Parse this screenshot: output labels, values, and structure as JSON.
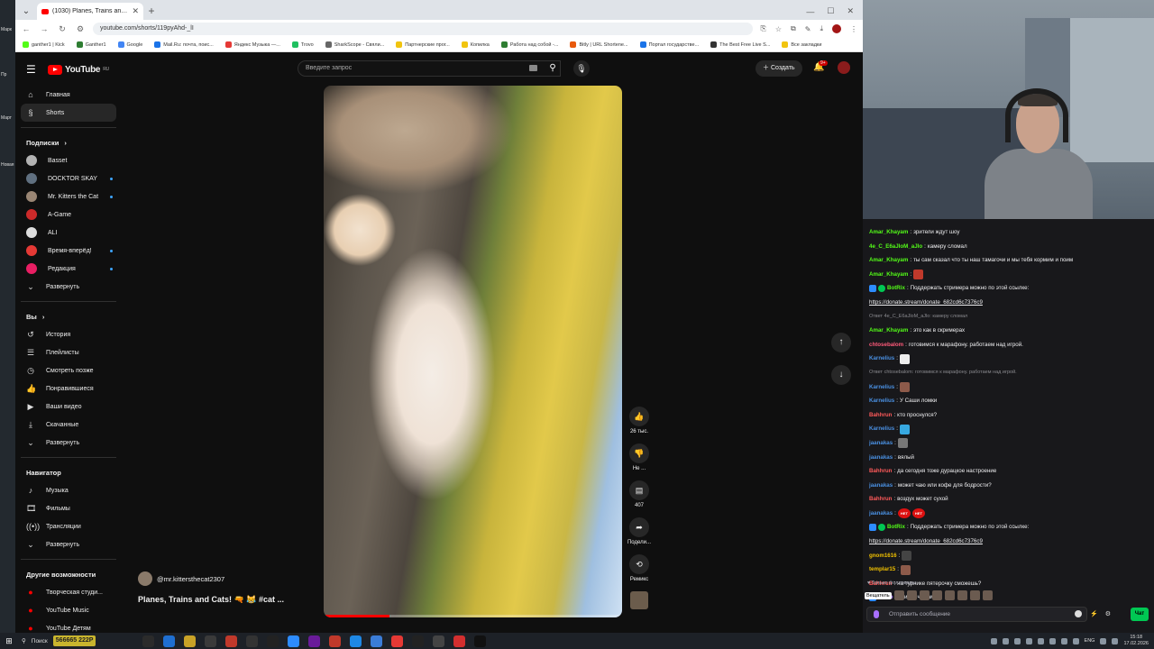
{
  "browser": {
    "tab_title": "(1030) Planes, Trains and C...",
    "url": "youtube.com/shorts/119pyAhd-_lI",
    "bookmarks": [
      "ganther1 | Kick",
      "Ganther1",
      "Google",
      "Mail.Ru: почта, поис...",
      "Яндекс Музыка —...",
      "Trovo",
      "SharkScope - Свяли...",
      "Партнерские прог...",
      "Копилка",
      "Работа над собой -...",
      "Bitly | URL Shortene...",
      "Портал государстве...",
      "The Best Free Live S...",
      "Все закладки"
    ],
    "bookmark_colors": [
      "#53fc18",
      "#2e7d32",
      "#4285f4",
      "#1a73e8",
      "#e53935",
      "#20c060",
      "#666666",
      "#f1c40f",
      "#f1c40f",
      "#2e7d32",
      "#e8590c",
      "#1a73e8",
      "#333333",
      "#f1c40f"
    ]
  },
  "youtube": {
    "logo_text": "YouTube",
    "region": "RU",
    "search_placeholder": "Введите запрос",
    "create_label": "Создать",
    "notifications": "9+",
    "sidebar": {
      "main": [
        {
          "label": "Главная",
          "icon": "home-icon",
          "glyph": "⌂"
        },
        {
          "label": "Shorts",
          "icon": "shorts-icon",
          "glyph": "§"
        }
      ],
      "subs_header": "Подписки",
      "subs": [
        {
          "label": "Basset",
          "color": "#b3b3b3",
          "live": false
        },
        {
          "label": "DOCKTOR SKAY",
          "color": "#607080",
          "live": true
        },
        {
          "label": "Mr. Kitters the Cat",
          "color": "#9a8674",
          "live": true
        },
        {
          "label": "A-Game",
          "color": "#cc2a2a",
          "live": false
        },
        {
          "label": "ALI",
          "color": "#dddddd",
          "live": false
        },
        {
          "label": "Время-вперёд!",
          "color": "#e53935",
          "live": true
        },
        {
          "label": "Редакция",
          "color": "#e91e63",
          "live": true
        }
      ],
      "subs_expand": "Развернуть",
      "you_header": "Вы",
      "you_items": [
        {
          "label": "История",
          "glyph": "↺"
        },
        {
          "label": "Плейлисты",
          "glyph": "☰"
        },
        {
          "label": "Смотреть позже",
          "glyph": "◷"
        },
        {
          "label": "Понравившиеся",
          "glyph": "👍"
        },
        {
          "label": "Ваши видео",
          "glyph": "▶"
        },
        {
          "label": "Скачанные",
          "glyph": "⤓"
        },
        {
          "label": "Развернуть",
          "glyph": "⌄"
        }
      ],
      "nav_header": "Навигатор",
      "nav_items": [
        {
          "label": "Музыка",
          "glyph": "♪"
        },
        {
          "label": "Фильмы",
          "glyph": "🎞"
        },
        {
          "label": "Трансляции",
          "glyph": "((•))"
        },
        {
          "label": "Развернуть",
          "glyph": "⌄"
        }
      ],
      "more_header": "Другие возможности",
      "more_items": [
        "Творческая студи...",
        "YouTube Music",
        "YouTube Детям"
      ]
    },
    "short": {
      "channel": "@mr.kittersthecat2307",
      "title": "Planes, Trains and Cats! 🔫 😹 #cat ...",
      "progress": 0.22,
      "actions": [
        {
          "icon": "like-icon",
          "glyph": "👍",
          "label": "26 тыс."
        },
        {
          "icon": "dislike-icon",
          "glyph": "👎",
          "label": "Не ..."
        },
        {
          "icon": "comment-icon",
          "glyph": "▤",
          "label": "407"
        },
        {
          "icon": "share-icon",
          "glyph": "➦",
          "label": "Подели..."
        },
        {
          "icon": "remix-icon",
          "glyph": "⟲",
          "label": "Ремикс"
        }
      ]
    }
  },
  "chat": {
    "messages": [
      {
        "user": "Amar_Khayam",
        "color": "#53fc18",
        "text": "зрители ждут шоу"
      },
      {
        "user": "4e_C_E6aJloM_aJlo",
        "color": "#53fc18",
        "text": "камеру сломал"
      },
      {
        "user": "Amar_Khayam",
        "color": "#53fc18",
        "text": "ты сам сказал что ты наш тамагочи и мы тебя кормим и поим"
      },
      {
        "user": "Amar_Khayam",
        "color": "#53fc18",
        "text": "",
        "emote": "#c0392b"
      },
      {
        "user": "BotRix",
        "color": "#53fc18",
        "text": "Поддержать стримера можно по этой ссылке:",
        "bot": true
      },
      {
        "user": "",
        "color": "#efeff1",
        "link": "https://donate.stream/donate_682cd6c7376c9"
      },
      {
        "reply": "Ответ 4e_C_E6aJloM_aJlo: камеру сломал"
      },
      {
        "user": "Amar_Khayam",
        "color": "#53fc18",
        "text": "это как в скримерах"
      },
      {
        "user": "chtosebalom",
        "color": "#ff5a7a",
        "text": "готовимся к марафону. работаем над игрой."
      },
      {
        "user": "Karnelius",
        "color": "#4a90e2",
        "text": "",
        "emote": "#eeeeee"
      },
      {
        "reply": "Ответ chtosebalom: готовимся к марафону. работаем над игрой."
      },
      {
        "user": "Karnelius",
        "color": "#4a90e2",
        "text": "",
        "emote": "#8d5a4a"
      },
      {
        "user": "Karnelius",
        "color": "#4a90e2",
        "text": "У Саши ломки"
      },
      {
        "user": "Bahhrun",
        "color": "#ff5a5a",
        "text": "кто проснулся?"
      },
      {
        "user": "Karnelius",
        "color": "#4a90e2",
        "text": "",
        "emote": "#37a8e0"
      },
      {
        "user": "jaanakas",
        "color": "#4a90e2",
        "text": "",
        "emote": "#777777"
      },
      {
        "user": "jaanakas",
        "color": "#4a90e2",
        "text": "вялый"
      },
      {
        "user": "Bahhrun",
        "color": "#ff5a5a",
        "text": "да сегодня тоже дурацкое настроение"
      },
      {
        "user": "jaanakas",
        "color": "#4a90e2",
        "text": "может чаю или кофе для бодрости?"
      },
      {
        "user": "Bahhrun",
        "color": "#ff5a5a",
        "text": "воздух может сухой"
      },
      {
        "user": "jaanakas",
        "color": "#4a90e2",
        "text": "",
        "no_no": "НЕТ"
      },
      {
        "user": "BotRix",
        "color": "#53fc18",
        "text": "Поддержать стримера можно по этой ссылке:",
        "bot": true
      },
      {
        "user": "",
        "color": "#efeff1",
        "link": "https://donate.stream/donate_682cd6c7376c9"
      },
      {
        "user": "gnom1616",
        "color": "#f0c000",
        "text": "",
        "emote": "#444444"
      },
      {
        "user": "templar15",
        "color": "#f0c000",
        "text": "",
        "emote": "#8d5a4a"
      },
      {
        "user": "Bahhrun",
        "color": "#ff5a5a",
        "text": "на турнике пятерочку сможешь?"
      },
      {
        "user": "nihao",
        "color": "#b07cff",
        "text": "привет че там",
        "bot_badge": true
      }
    ],
    "followers_label": "Только фолловеры",
    "broadcaster_label": "Вещатель",
    "input_placeholder": "Отправить сообщение",
    "send_label": "Чат"
  },
  "taskbar": {
    "search": "Поиск",
    "doge_text": "566665 222P",
    "lang": "ENG",
    "time": "15:18",
    "date": "17.02.2026",
    "app_colors": [
      "#2b2b2b",
      "#1f6fd1",
      "#c9a227",
      "#3a3a3a",
      "#c0392b",
      "#333",
      "#222",
      "#2d8cff",
      "#6a1b9a",
      "#c0392b",
      "#1e88e5",
      "#3b7dd8",
      "#e53935",
      "#222",
      "#444",
      "#d32f2f",
      "#111"
    ]
  },
  "desktop": {
    "left_labels": [
      "Марк",
      "Пр",
      "Март",
      "Новая"
    ]
  }
}
